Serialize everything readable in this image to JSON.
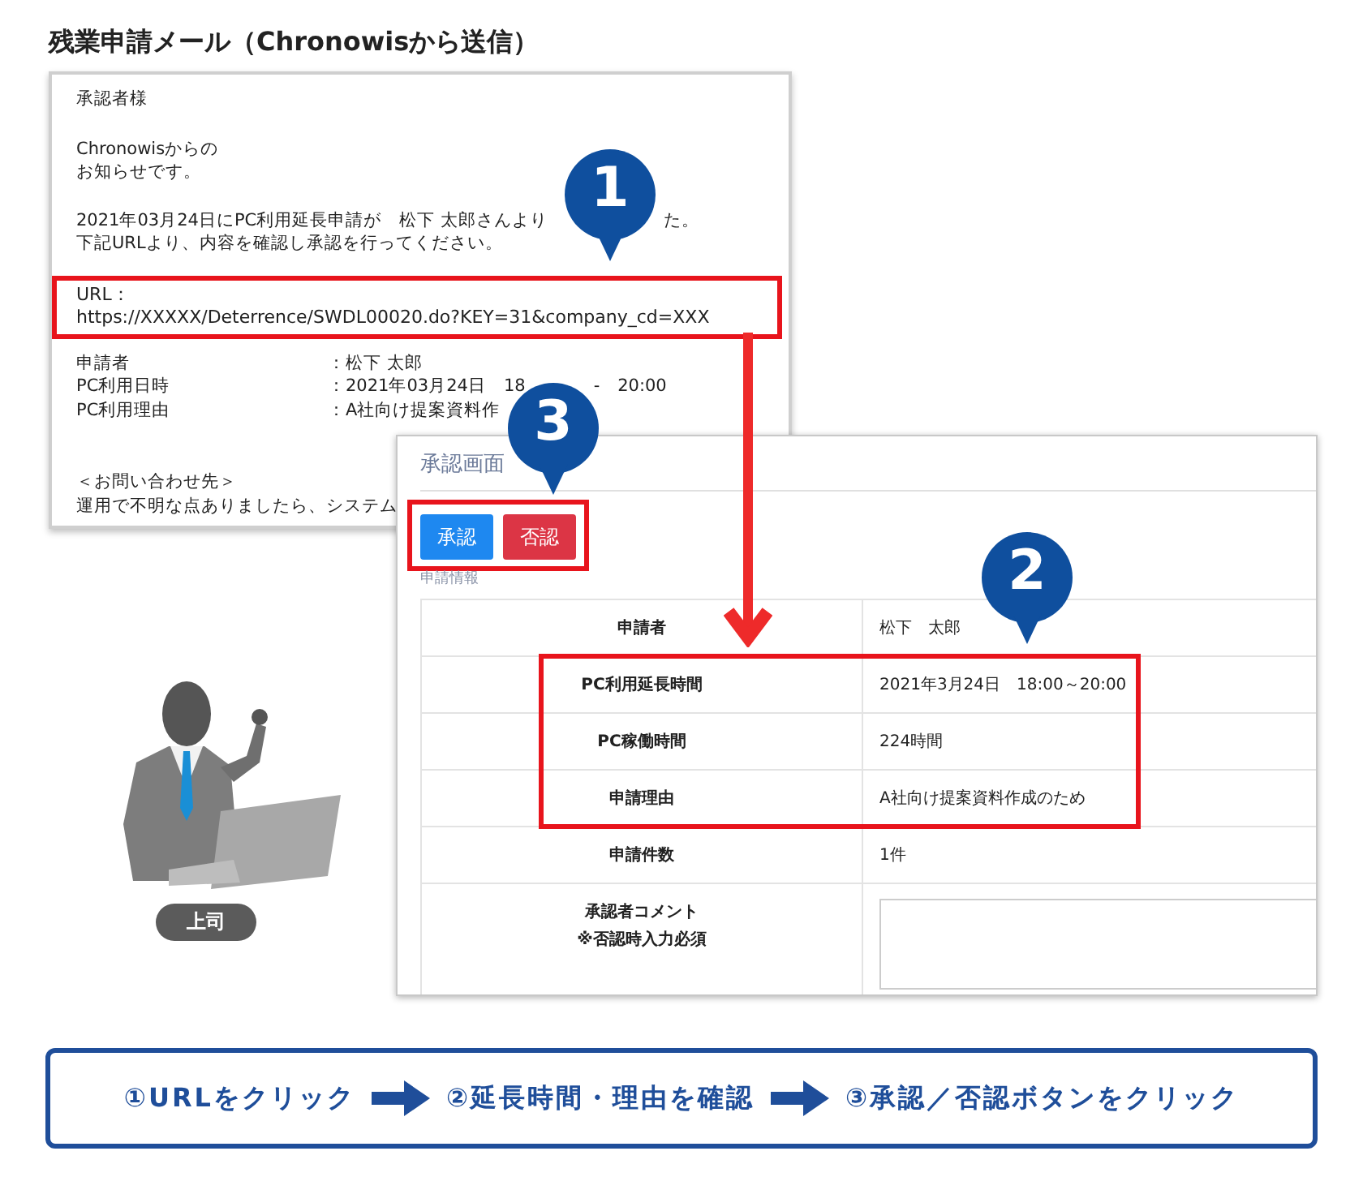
{
  "title": "残業申請メール（Chronowisから送信）",
  "email": {
    "greeting": "承認者様",
    "intro_lines": [
      "Chronowisからの",
      "お知らせです。"
    ],
    "notice_start": "2021年03月24日にPC利用延長申請が　松下 太郎さんより",
    "notice_end": "た。",
    "notice_second": "下記URLより、内容を確認し承認を行ってください。",
    "url_label": "URL：",
    "url": "https://XXXXX/Deterrence/SWDL00020.do?KEY=31&company_cd=XXX",
    "fields": [
      {
        "label": "申請者",
        "values": [
          "：松下 太郎"
        ]
      },
      {
        "label": "PC利用日時",
        "values": [
          "：2021年03月24日　18",
          "-　20:00"
        ]
      },
      {
        "label": "PC利用理由",
        "values": [
          "：A社向け提案資料作"
        ]
      }
    ],
    "contact_heading": "＜お問い合わせ先＞",
    "contact_text": "運用で不明な点ありましたら、システム"
  },
  "approval_screen": {
    "title": "承認画面",
    "buttons": [
      {
        "label": "承認",
        "kind": "approve"
      },
      {
        "label": "否認",
        "kind": "reject"
      }
    ],
    "section_label": "申請情報",
    "rows": [
      {
        "kind": "text",
        "label": "申請者",
        "value": "松下　太郎",
        "highlighted": false
      },
      {
        "kind": "text",
        "label": "PC利用延長時間",
        "value": "2021年3月24日　18:00～20:00",
        "highlighted": true
      },
      {
        "kind": "text",
        "label": "PC稼働時間",
        "value": "224時間",
        "highlighted": true
      },
      {
        "kind": "text",
        "label": "申請理由",
        "value": "A社向け提案資料作成のため",
        "highlighted": true
      },
      {
        "kind": "text",
        "label": "申請件数",
        "value": "1件",
        "highlighted": false
      },
      {
        "kind": "textarea",
        "label": "承認者コメント",
        "note": "※否認時入力必須",
        "highlighted": false
      }
    ]
  },
  "callouts": [
    "1",
    "3",
    "2"
  ],
  "person": {
    "badge": "上司"
  },
  "steps": [
    "①URLをクリック",
    "②延長時間・理由を確認",
    "③承認／否認ボタンをクリック"
  ]
}
